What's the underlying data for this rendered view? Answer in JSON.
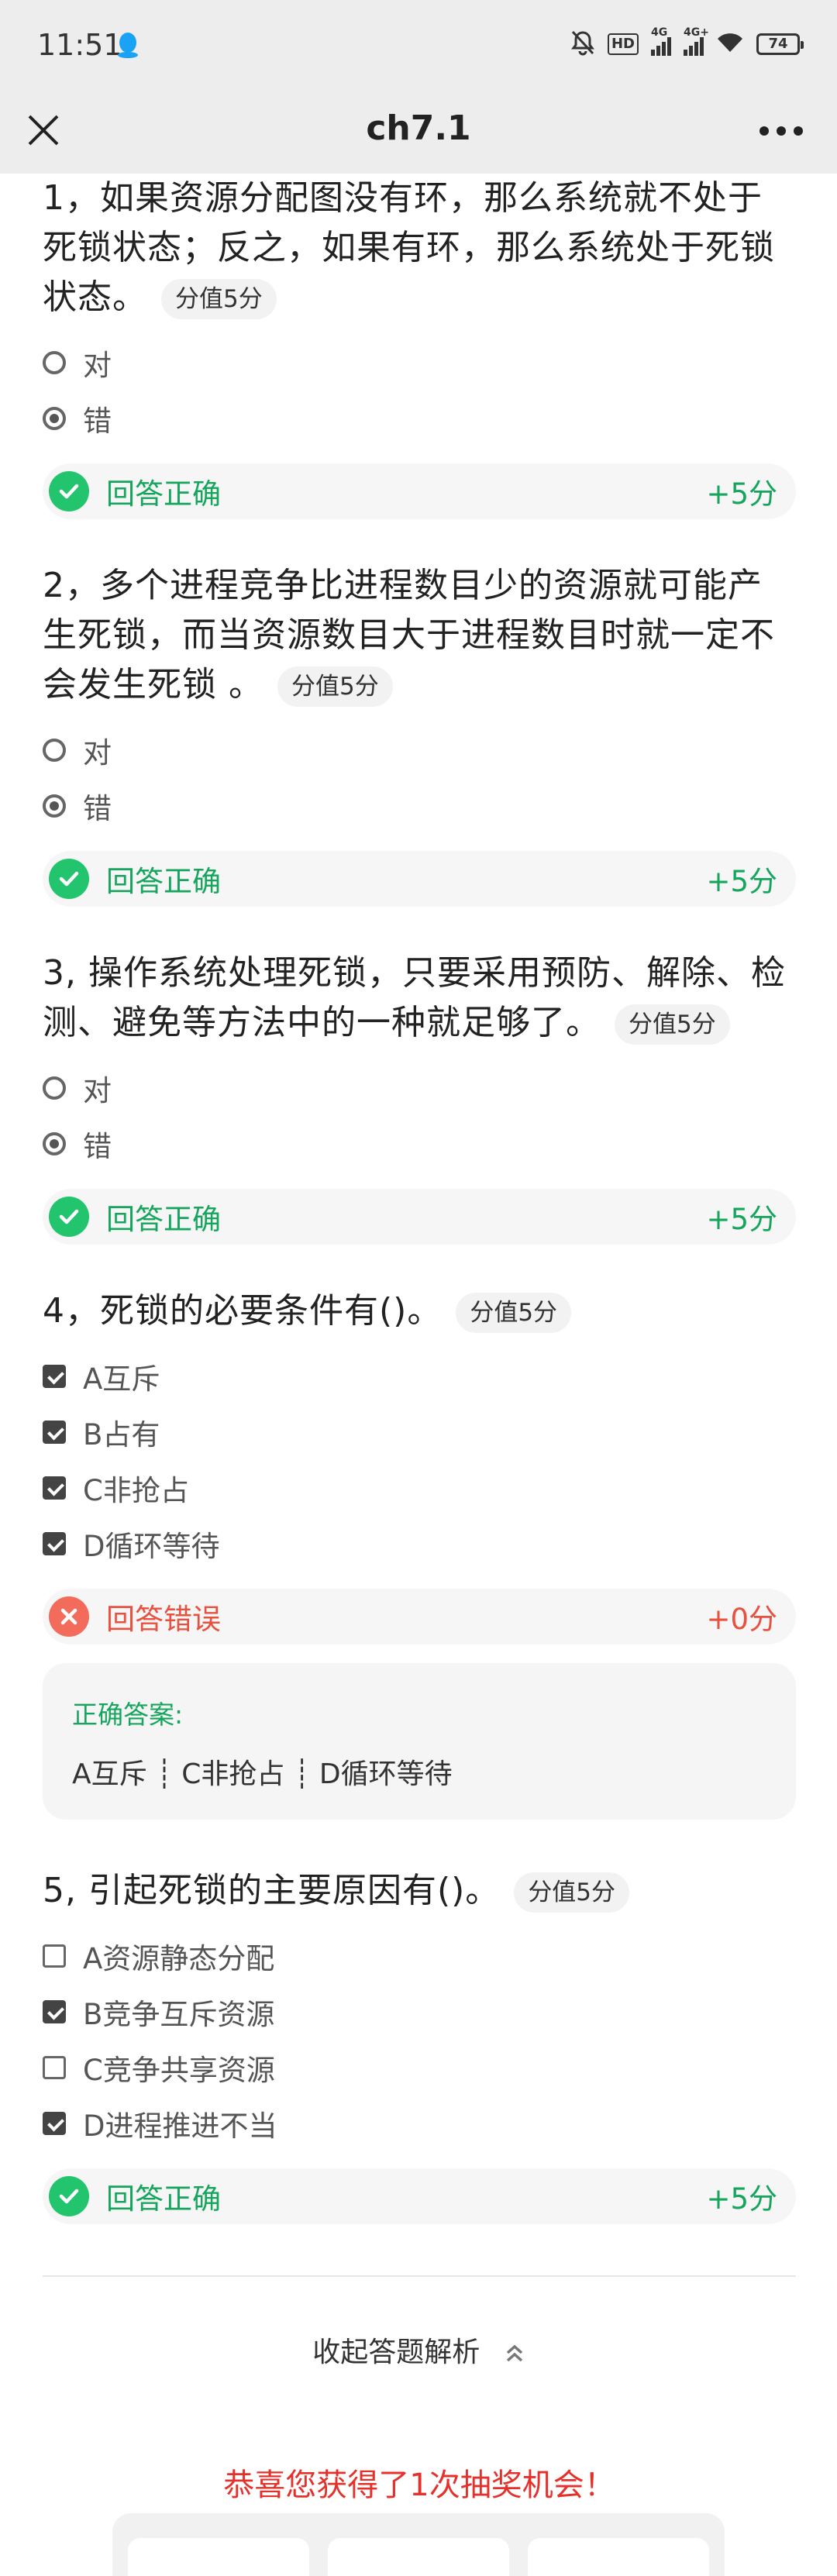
{
  "status_bar": {
    "time": "11:51",
    "hd_label": "HD",
    "signal1_label": "4G",
    "signal2_label": "4G+",
    "battery": "74"
  },
  "nav": {
    "title": "ch7.1",
    "close_icon": "close-icon",
    "more_icon": "more-dots-icon"
  },
  "colors": {
    "correct": "#16a55d",
    "wrong": "#e8503f",
    "lottery": "#e4312b"
  },
  "questions": [
    {
      "text": "1，如果资源分配图没有环，那么系统就不处于死锁状态；反之，如果有环，那么系统处于死锁状态。",
      "score": "分值5分",
      "options": [
        {
          "label": "对",
          "selected": false
        },
        {
          "label": "错",
          "selected": true
        }
      ],
      "result": "回答正确",
      "points": "+5分"
    },
    {
      "text": "2，多个进程竞争比进程数目少的资源就可能产生死锁，而当资源数目大于进程数目时就一定不会发生死锁 。",
      "score": "分值5分",
      "options": [
        {
          "label": "对",
          "selected": false
        },
        {
          "label": "错",
          "selected": true
        }
      ],
      "result": "回答正确",
      "points": "+5分"
    },
    {
      "text": "3, 操作系统处理死锁，只要采用预防、解除、检测、避免等方法中的一种就足够了。",
      "score": "分值5分",
      "options": [
        {
          "label": "对",
          "selected": false
        },
        {
          "label": "错",
          "selected": true
        }
      ],
      "result": "回答正确",
      "points": "+5分"
    },
    {
      "text": "4，死锁的必要条件有()。",
      "score": "分值5分",
      "options": [
        {
          "label": "A互斥",
          "selected": true
        },
        {
          "label": "B占有",
          "selected": true
        },
        {
          "label": "C非抢占",
          "selected": true
        },
        {
          "label": "D循环等待",
          "selected": true
        }
      ],
      "result": "回答错误",
      "points": "+0分",
      "correct_answer_label": "正确答案:",
      "correct_answer": "A互斥 ┊ C非抢占 ┊ D循环等待"
    },
    {
      "text": "5, 引起死锁的主要原因有()。",
      "score": "分值5分",
      "options": [
        {
          "label": "A资源静态分配",
          "selected": false
        },
        {
          "label": "B竞争互斥资源",
          "selected": true
        },
        {
          "label": "C竞争共享资源",
          "selected": false
        },
        {
          "label": "D进程推进不当",
          "selected": true
        }
      ],
      "result": "回答正确",
      "points": "+5分"
    }
  ],
  "footer": {
    "collapse_label": "收起答题解析",
    "lottery_text": "恭喜您获得了1次抽奖机会！"
  }
}
